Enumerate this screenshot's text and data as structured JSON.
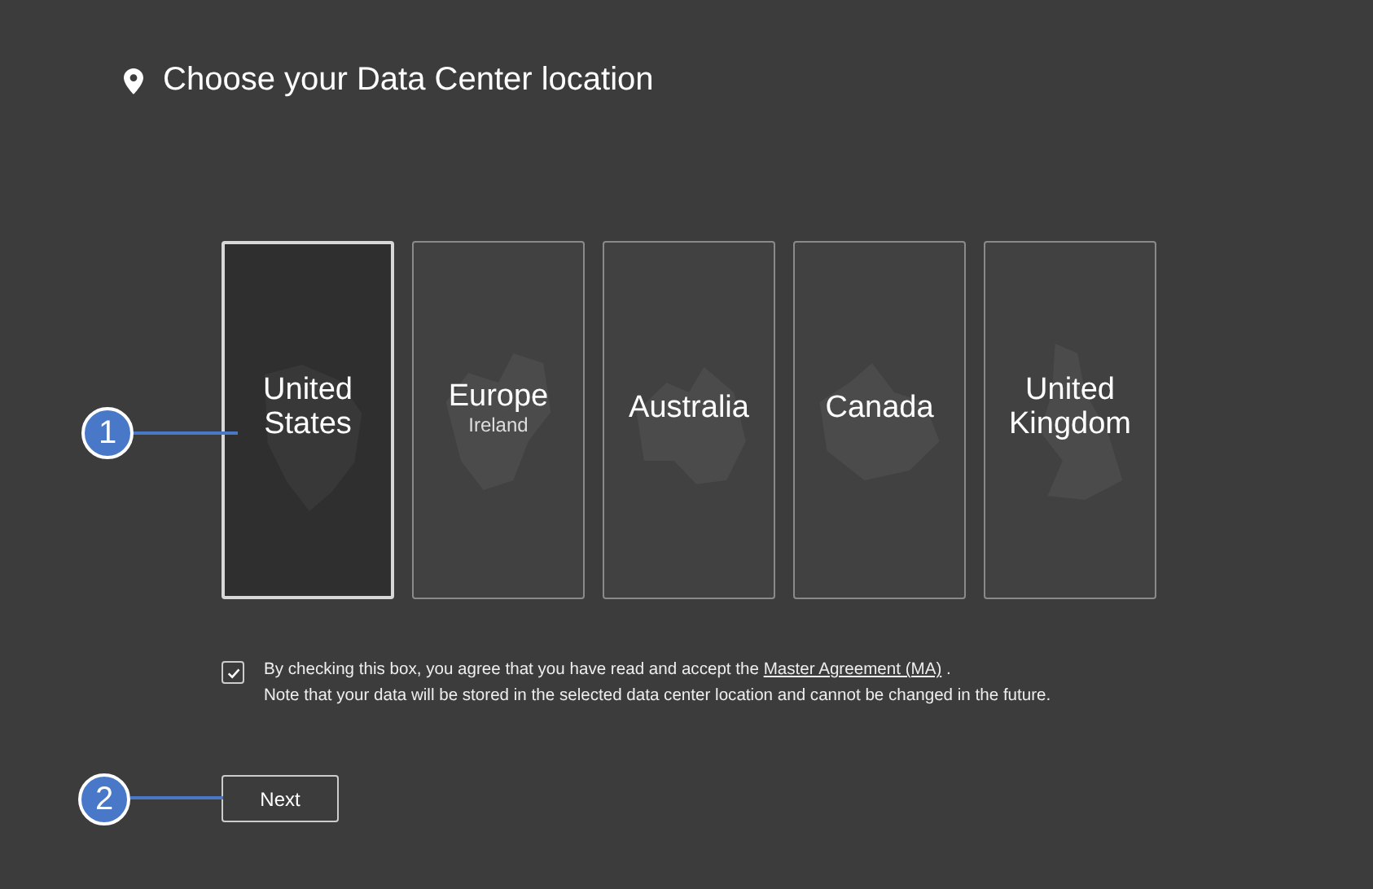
{
  "title": "Choose your Data Center location",
  "locations": [
    {
      "name": "United States",
      "selected": true
    },
    {
      "name": "Europe",
      "subtitle": "Ireland",
      "selected": false
    },
    {
      "name": "Australia",
      "selected": false
    },
    {
      "name": "Canada",
      "selected": false
    },
    {
      "name": "United Kingdom",
      "selected": false
    }
  ],
  "agreement": {
    "checked": true,
    "text_before": "By checking this box, you agree that you have read and accept the",
    "link": "Master Agreement (MA)",
    "text_after": ".",
    "note": "Note that your data will be stored in the selected data center location and cannot be changed in the future."
  },
  "next_button": "Next",
  "callouts": [
    {
      "number": "1"
    },
    {
      "number": "2"
    }
  ]
}
